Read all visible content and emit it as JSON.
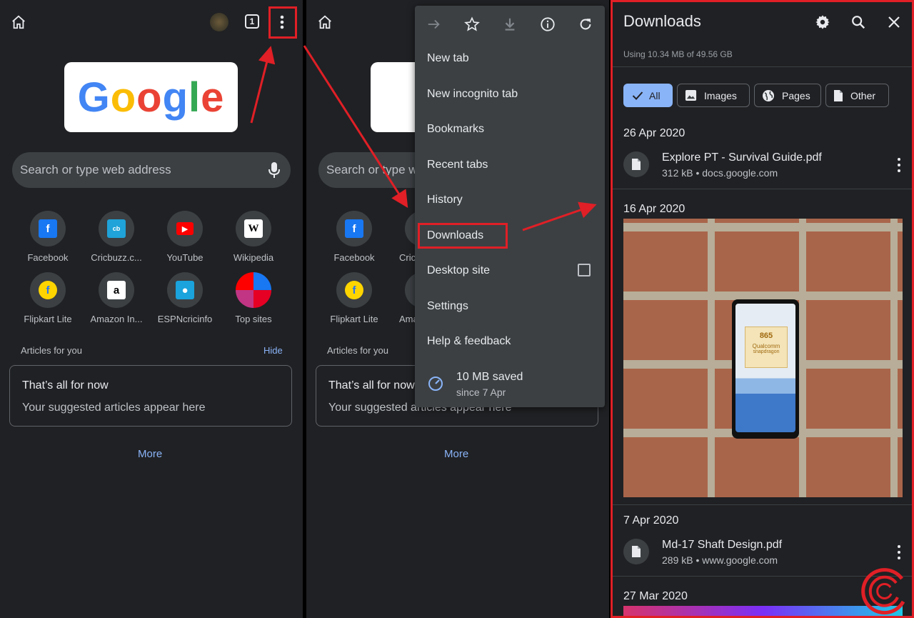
{
  "left_panel": {
    "tab_count": "1",
    "search_placeholder": "Search or type web address",
    "doodle_text": [
      "G",
      "o",
      "o",
      "g",
      "l",
      "e"
    ],
    "tiles": [
      {
        "label": "Facebook",
        "glyph": "f",
        "color": "#1877f2"
      },
      {
        "label": "Cricbuzz.c...",
        "glyph": "cb",
        "color": "#1fa3d8"
      },
      {
        "label": "YouTube",
        "glyph": "▶",
        "color": "#ff0000"
      },
      {
        "label": "Wikipedia",
        "glyph": "W",
        "color": "#ffffff"
      },
      {
        "label": "Flipkart Lite",
        "glyph": "f",
        "color": "#2874f0"
      },
      {
        "label": "Amazon In...",
        "glyph": "a",
        "color": "#ffffff"
      },
      {
        "label": "ESPNcricinfo",
        "glyph": "●",
        "color": "#1aa3dc"
      },
      {
        "label": "Top sites",
        "glyph": "",
        "color": "#1877f2"
      }
    ],
    "articles_label": "Articles for you",
    "hide_label": "Hide",
    "card_title": "That’s all for now",
    "card_sub": "Your suggested articles appear here",
    "more_label": "More"
  },
  "middle_panel": {
    "search_partial": "Search or type we",
    "tiles": [
      {
        "label": "Facebook"
      },
      {
        "label": "Cric"
      },
      {
        "label": "Flipkart Lite"
      },
      {
        "label": "Ama"
      }
    ],
    "articles_label": "Articles for you",
    "card_title": "That’s all for now",
    "card_sub": "Your suggested articles appear here",
    "more_label": "More"
  },
  "menu": {
    "items": [
      "New tab",
      "New incognito tab",
      "Bookmarks",
      "Recent tabs",
      "History",
      "Downloads",
      "Desktop site",
      "Settings",
      "Help & feedback"
    ],
    "saved_title": "10 MB saved",
    "saved_sub": "since 7 Apr"
  },
  "downloads": {
    "title": "Downloads",
    "usage": "Using 10.34 MB of 49.56 GB",
    "chips": [
      "All",
      "Images",
      "Pages",
      "Other"
    ],
    "groups": [
      {
        "date": "26 Apr 2020",
        "file": "Explore PT - Survival Guide.pdf",
        "meta": "312 kB • docs.google.com"
      },
      {
        "date": "16 Apr 2020"
      },
      {
        "date": "7 Apr 2020",
        "file": "Md-17 Shaft Design.pdf",
        "meta": "289 kB • www.google.com"
      },
      {
        "date": "27 Mar 2020"
      }
    ],
    "phone_chip_number": "865",
    "phone_chip_brand": "Qualcomm",
    "phone_chip_sub": "snapdragon"
  },
  "colors": {
    "annotation_red": "#e01f26",
    "accent_blue": "#8ab4f8",
    "bg": "#202124"
  }
}
